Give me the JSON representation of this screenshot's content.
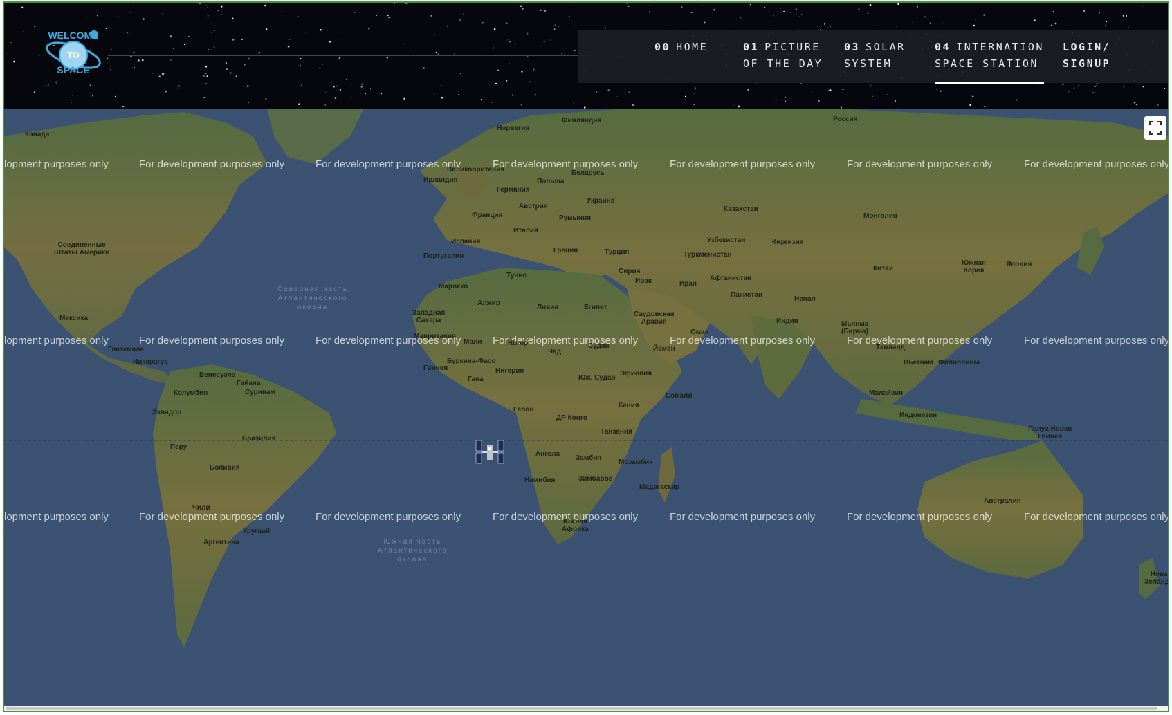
{
  "nav": {
    "items": [
      {
        "num": "00",
        "label": "HOME",
        "label2": ""
      },
      {
        "num": "01",
        "label": "PICTURE",
        "label2": "OF THE DAY"
      },
      {
        "num": "03",
        "label": "SOLAR",
        "label2": "SYSTEM"
      },
      {
        "num": "04",
        "label": "INTERNATION",
        "label2": "SPACE STATION"
      }
    ],
    "login_line1": "LOGIN/",
    "login_line2": "SIGNUP",
    "active_index": 3
  },
  "logo": {
    "text_top": "WELCOME",
    "text_mid": "TO",
    "text_bottom": "SPACE",
    "color": "#3fa9e0"
  },
  "map": {
    "watermark": "For development purposes only",
    "watermark_partial": "lopment purposes only",
    "oceans": {
      "north_atlantic": "Северная часть\nАтлантического\nокеана",
      "south_atlantic": "Южная часть\nАтлантического\nокеана"
    },
    "countries": {
      "kanada": "Канада",
      "usa": "Соединенные\nШтаты Америки",
      "mexico": "Мексика",
      "venezuela": "Венесуэла",
      "colombia": "Колумбия",
      "ecuador": "Эквадор",
      "peru": "Перу",
      "brazil": "Бразилия",
      "bolivia": "Боливия",
      "chile": "Чили",
      "argentina": "Аргентина",
      "uruguay": "Уругвай",
      "guyana": "Гайана",
      "suriname": "Суринам",
      "guatemala": "Гватемала",
      "nicaragua": "Никарагуа",
      "norway": "Норвегия",
      "finland": "Финляндия",
      "russia": "Россия",
      "uk": "Великобритания",
      "ireland": "Ирландия",
      "germany": "Германия",
      "poland": "Польша",
      "belarus": "Беларусь",
      "ukraine": "Украина",
      "austria": "Австрия",
      "france": "Франция",
      "romania": "Румыния",
      "italy": "Италия",
      "spain": "Испания",
      "portugal": "Португалия",
      "greece": "Греция",
      "turkey": "Турция",
      "kazakhstan": "Казахстан",
      "mongolia": "Монголия",
      "uzbekistan": "Узбекистан",
      "kyrgyzstan": "Киргизия",
      "turkmenistan": "Туркменистан",
      "china": "Китай",
      "korea": "Южная\nКорея",
      "japan": "Япония",
      "iran": "Иран",
      "iraq": "Ирак",
      "syria": "Сирия",
      "afghanistan": "Афганистан",
      "pakistan": "Пакистан",
      "nepal": "Непал",
      "india": "Индия",
      "myanmar": "Мьянма\n(Бирма)",
      "thailand": "Таиланд",
      "vietnam": "Вьетнам",
      "philippines": "Филиппины",
      "malaysia": "Малайзия",
      "indonesia": "Индонезия",
      "png": "Папуа Новая\nГвинея",
      "australia": "Австралия",
      "nz": "Новая\nЗеландия",
      "saudi": "Саудовская\nАравия",
      "oman": "Оман",
      "yemen": "Йемен",
      "morocco": "Марокко",
      "algeria": "Алжир",
      "tunisia": "Тунис",
      "libya": "Ливия",
      "egypt": "Египет",
      "west_sahara": "Западная\nСахара",
      "mauritania": "Мавритания",
      "mali": "Мали",
      "niger": "Нигер",
      "chad": "Чад",
      "sudan": "Судан",
      "burkina": "Буркина-Фасо",
      "guinea": "Гвинея",
      "ghana": "Гана",
      "nigeria": "Нигерия",
      "s_sudan": "Юж. Судан",
      "ethiopia": "Эфиопия",
      "somalia": "Сомали",
      "kenya": "Кения",
      "gabon": "Габон",
      "drc": "ДР Конго",
      "tanzania": "Танзания",
      "angola": "Ангола",
      "zambia": "Замбия",
      "mozambique": "Мозамбик",
      "namibia": "Намибия",
      "zimbabwe": "Зимбабве",
      "madagascar": "Мадагаскар",
      "south_africa": "Южная\nАфрика"
    }
  },
  "colors": {
    "ocean": "#3b5273",
    "land": "#6e6a3d",
    "land_green": "#4f6a3e",
    "header_bg": "#05070c",
    "nav_bg": "#1c1e24"
  }
}
